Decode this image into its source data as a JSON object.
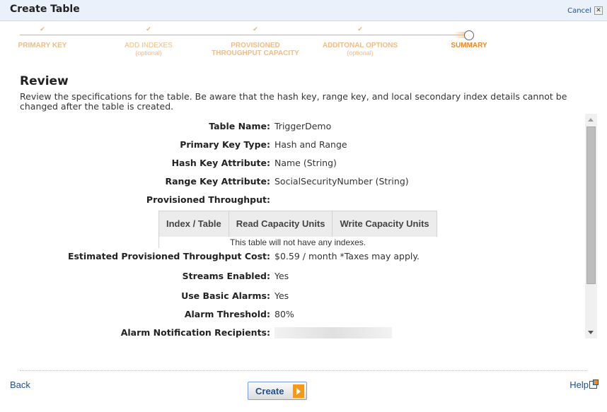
{
  "header": {
    "title": "Create Table",
    "cancel_label": "Cancel",
    "close_glyph": "✕"
  },
  "wizard": {
    "steps": [
      {
        "label": "PRIMARY KEY",
        "sub": "",
        "status": "completed",
        "icon": "checkmark"
      },
      {
        "label": "ADD INDEXES",
        "sub": "(optional)",
        "status": "completed",
        "icon": "checkmark"
      },
      {
        "label": "PROVISIONED",
        "label2": "THROUGHPUT CAPACITY",
        "sub": "",
        "status": "completed",
        "icon": "checkmark"
      },
      {
        "label": "ADDITONAL OPTIONS",
        "sub": "(optional)",
        "status": "completed",
        "icon": "checkmark"
      },
      {
        "label": "SUMMARY",
        "sub": "",
        "status": "current",
        "icon": "circle"
      }
    ],
    "check_glyph": "✔",
    "colors": {
      "completed": "#f0bc85",
      "current": "#e98a2b",
      "line": "#e8a96b"
    }
  },
  "review": {
    "title": "Review",
    "description": "Review the specifications for the table. Be aware that the hash key, range key, and local secondary index details cannot be changed after the table is created."
  },
  "details": {
    "table_name": {
      "label": "Table Name:",
      "value": "TriggerDemo"
    },
    "primary_key_type": {
      "label": "Primary Key Type:",
      "value": "Hash and Range"
    },
    "hash_key": {
      "label": "Hash Key Attribute:",
      "value": "Name (String)"
    },
    "range_key": {
      "label": "Range Key Attribute:",
      "value": "SocialSecurityNumber (String)"
    },
    "provisioned_throughput": {
      "label": "Provisioned Throughput:",
      "value": ""
    },
    "throughput_table": {
      "headers": [
        "Index / Table",
        "Read Capacity Units",
        "Write Capacity Units"
      ],
      "empty_message": "This table will not have any indexes."
    },
    "estimated_cost": {
      "label": "Estimated Provisioned Throughput Cost:",
      "value": "$0.59 / month *Taxes may apply."
    },
    "streams_enabled": {
      "label": "Streams Enabled:",
      "value": "Yes"
    },
    "basic_alarms": {
      "label": "Use Basic Alarms:",
      "value": "Yes"
    },
    "alarm_threshold": {
      "label": "Alarm Threshold:",
      "value": "80%"
    },
    "alarm_recipients": {
      "label": "Alarm Notification Recipients:",
      "value": ""
    }
  },
  "footer": {
    "back_label": "Back",
    "create_label": "Create",
    "help_label": "Help"
  }
}
